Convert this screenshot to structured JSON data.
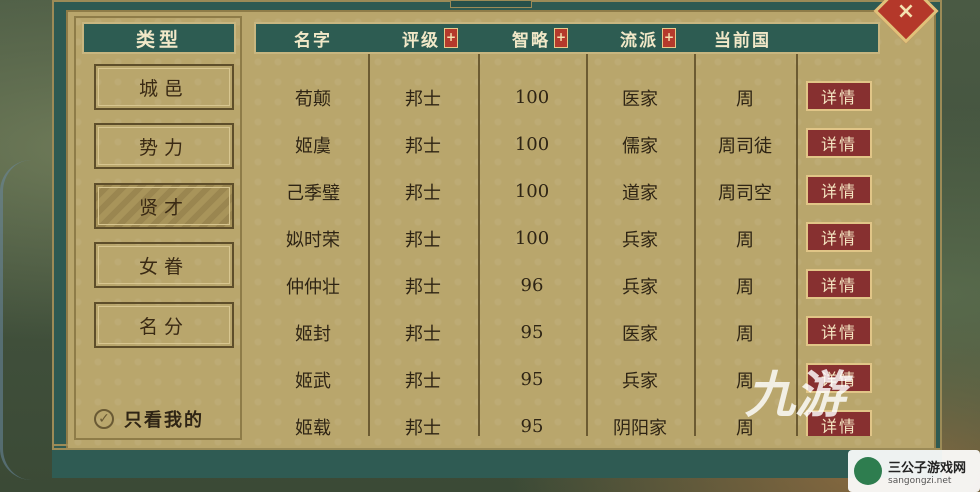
{
  "sidebar": {
    "header": "类型",
    "categories": [
      {
        "label": "城邑",
        "active": false
      },
      {
        "label": "势力",
        "active": false
      },
      {
        "label": "贤才",
        "active": true
      },
      {
        "label": "女眷",
        "active": false
      },
      {
        "label": "名分",
        "active": false
      }
    ],
    "filter": {
      "label": "只看我的",
      "checked": true
    }
  },
  "table": {
    "headers": {
      "name": "名字",
      "rank": "评级",
      "wisdom": "智略",
      "school": "流派",
      "state": "当前国"
    },
    "sort_icon": "+",
    "detail_label": "详情",
    "rows": [
      {
        "name": "荀颠",
        "rank": "邦士",
        "wisdom": "100",
        "school": "医家",
        "state": "周"
      },
      {
        "name": "姬虞",
        "rank": "邦士",
        "wisdom": "100",
        "school": "儒家",
        "state": "周司徒"
      },
      {
        "name": "己季璧",
        "rank": "邦士",
        "wisdom": "100",
        "school": "道家",
        "state": "周司空"
      },
      {
        "name": "姒时荣",
        "rank": "邦士",
        "wisdom": "100",
        "school": "兵家",
        "state": "周"
      },
      {
        "name": "仲仲壮",
        "rank": "邦士",
        "wisdom": "96",
        "school": "兵家",
        "state": "周"
      },
      {
        "name": "姬封",
        "rank": "邦士",
        "wisdom": "95",
        "school": "医家",
        "state": "周"
      },
      {
        "name": "姬武",
        "rank": "邦士",
        "wisdom": "95",
        "school": "兵家",
        "state": "周"
      },
      {
        "name": "姬载",
        "rank": "邦士",
        "wisdom": "95",
        "school": "阴阳家",
        "state": "周"
      }
    ]
  },
  "close_icon": "×",
  "watermark": {
    "text": "九游",
    "site_name": "三公子游戏网",
    "site_url": "sangongzi.net"
  }
}
